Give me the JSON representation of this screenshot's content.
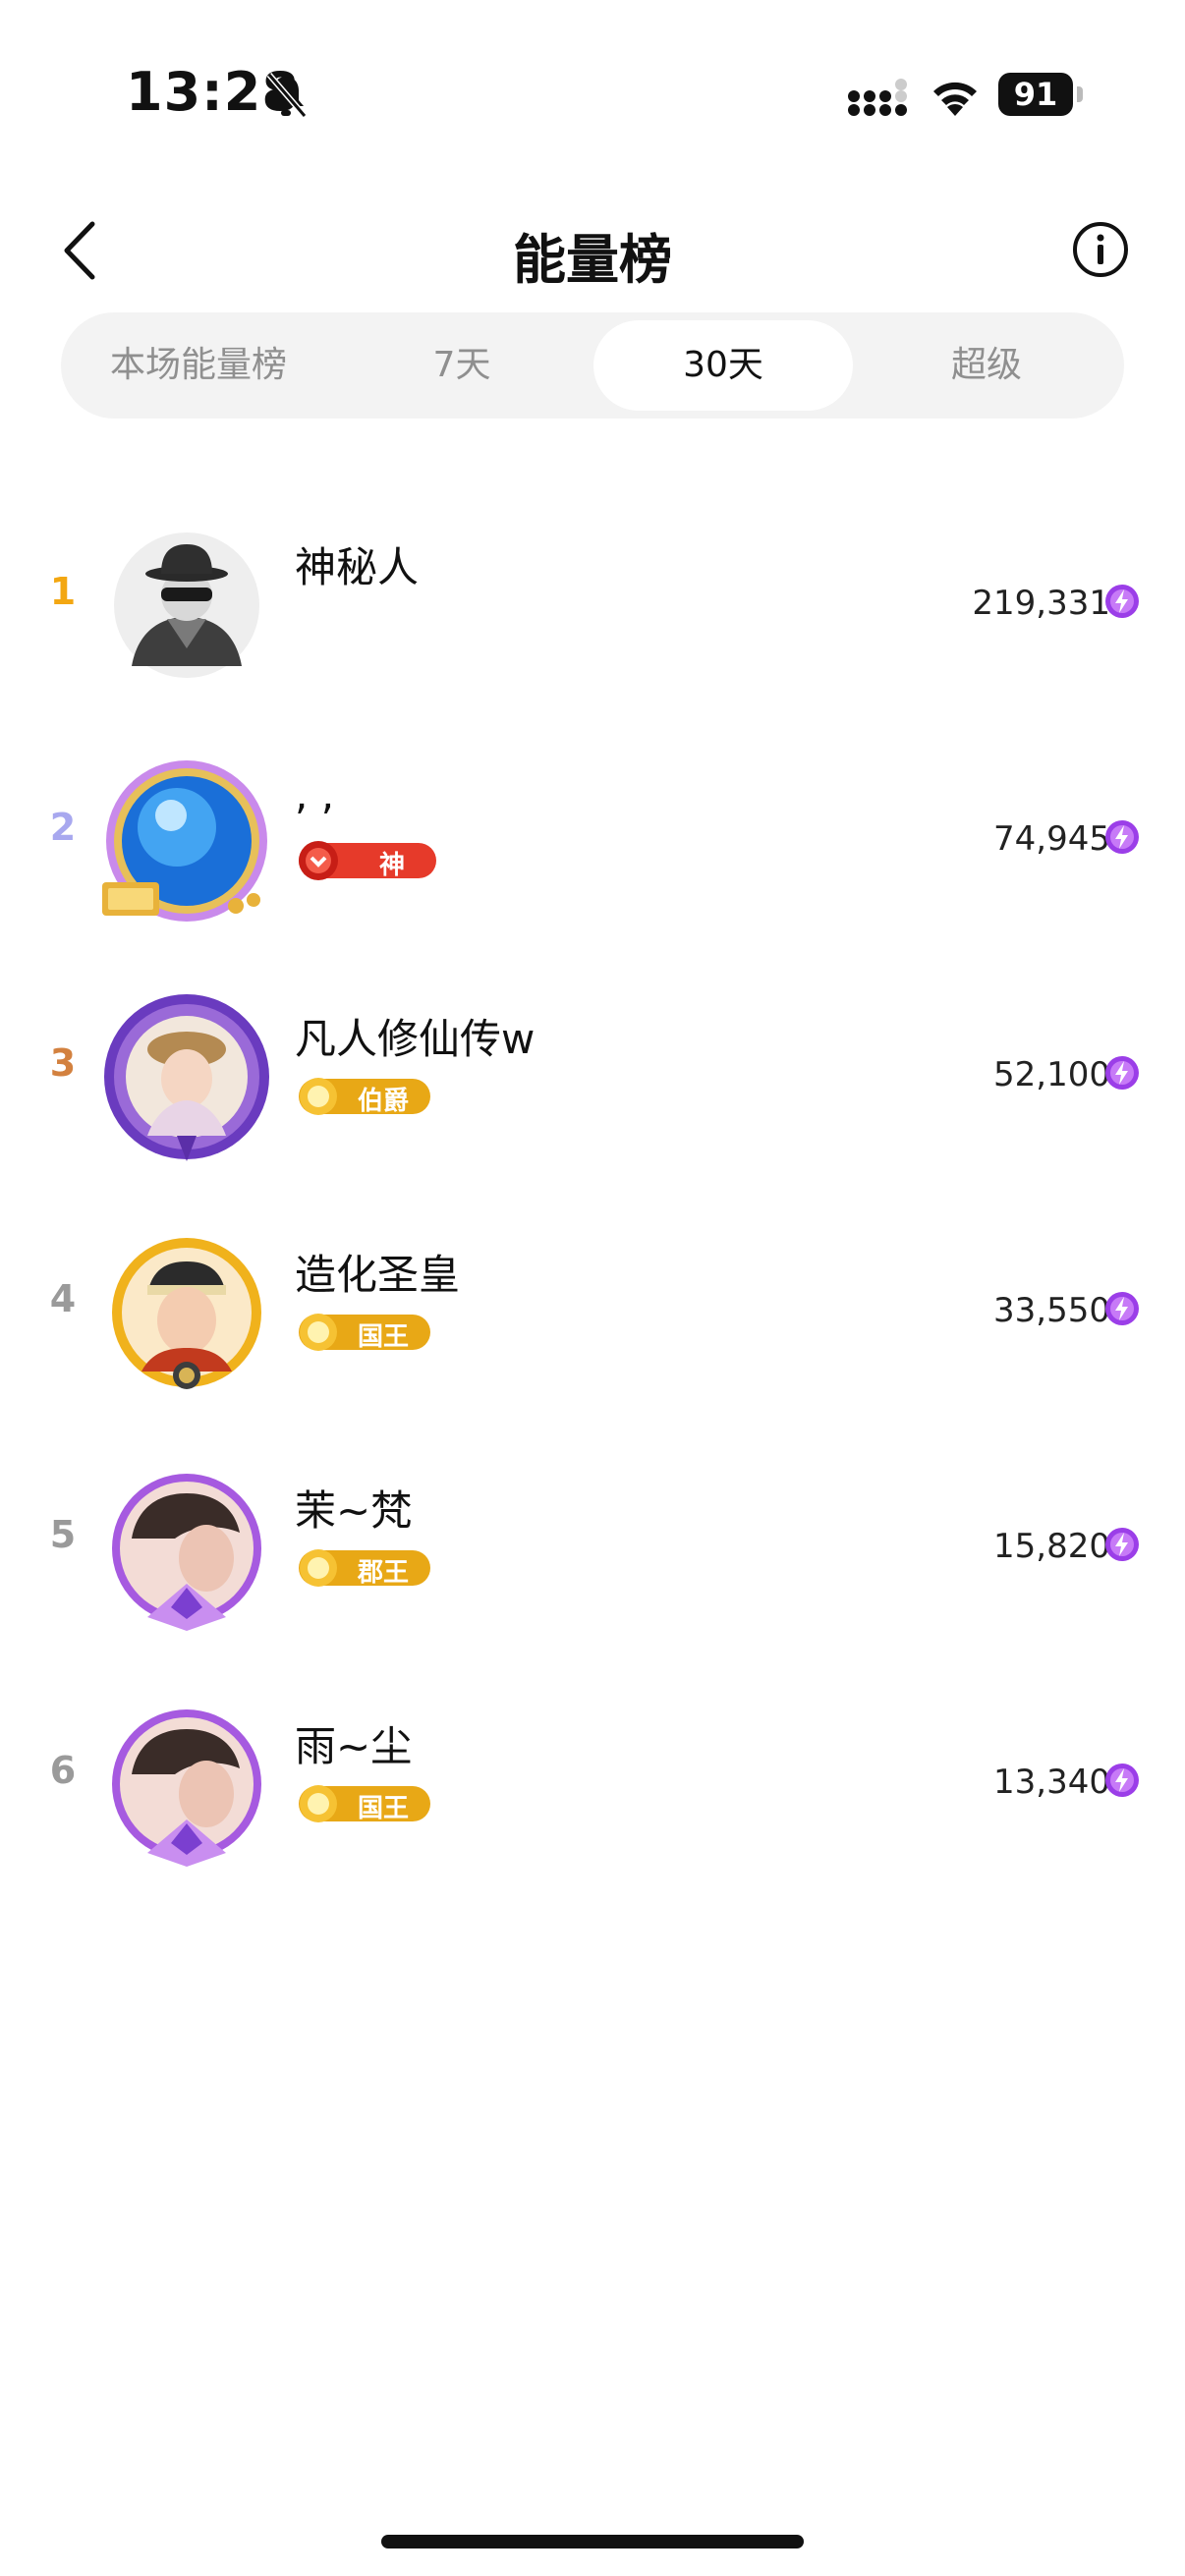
{
  "status_bar": {
    "time": "13:28",
    "battery": "91"
  },
  "header": {
    "title": "能量榜"
  },
  "tabs": [
    {
      "label": "本场能量榜",
      "active": false
    },
    {
      "label": "7天",
      "active": false
    },
    {
      "label": "30天",
      "active": true
    },
    {
      "label": "超级",
      "active": false
    }
  ],
  "rank_colors": {
    "1": "#f3a712",
    "2": "#a8a8ef",
    "3": "#d3813f",
    "default": "#9a9a9a"
  },
  "rankings": [
    {
      "rank": "1",
      "name": "神秘人",
      "badge": null,
      "score": "219,331",
      "avatar": "mystery-man"
    },
    {
      "rank": "2",
      "name": ", ,",
      "badge": "神",
      "score": "74,945",
      "avatar": "blue-orb"
    },
    {
      "rank": "3",
      "name": "凡人修仙传w",
      "badge": "伯爵",
      "score": "52,100",
      "avatar": "girl-photo"
    },
    {
      "rank": "4",
      "name": "造化圣皇",
      "badge": "国王",
      "score": "33,550",
      "avatar": "prince-portrait"
    },
    {
      "rank": "5",
      "name": "茉~梵",
      "badge": "郡王",
      "score": "15,820",
      "avatar": "profile-photo"
    },
    {
      "rank": "6",
      "name": "雨~尘",
      "badge": "国王",
      "score": "13,340",
      "avatar": "profile-photo"
    }
  ]
}
